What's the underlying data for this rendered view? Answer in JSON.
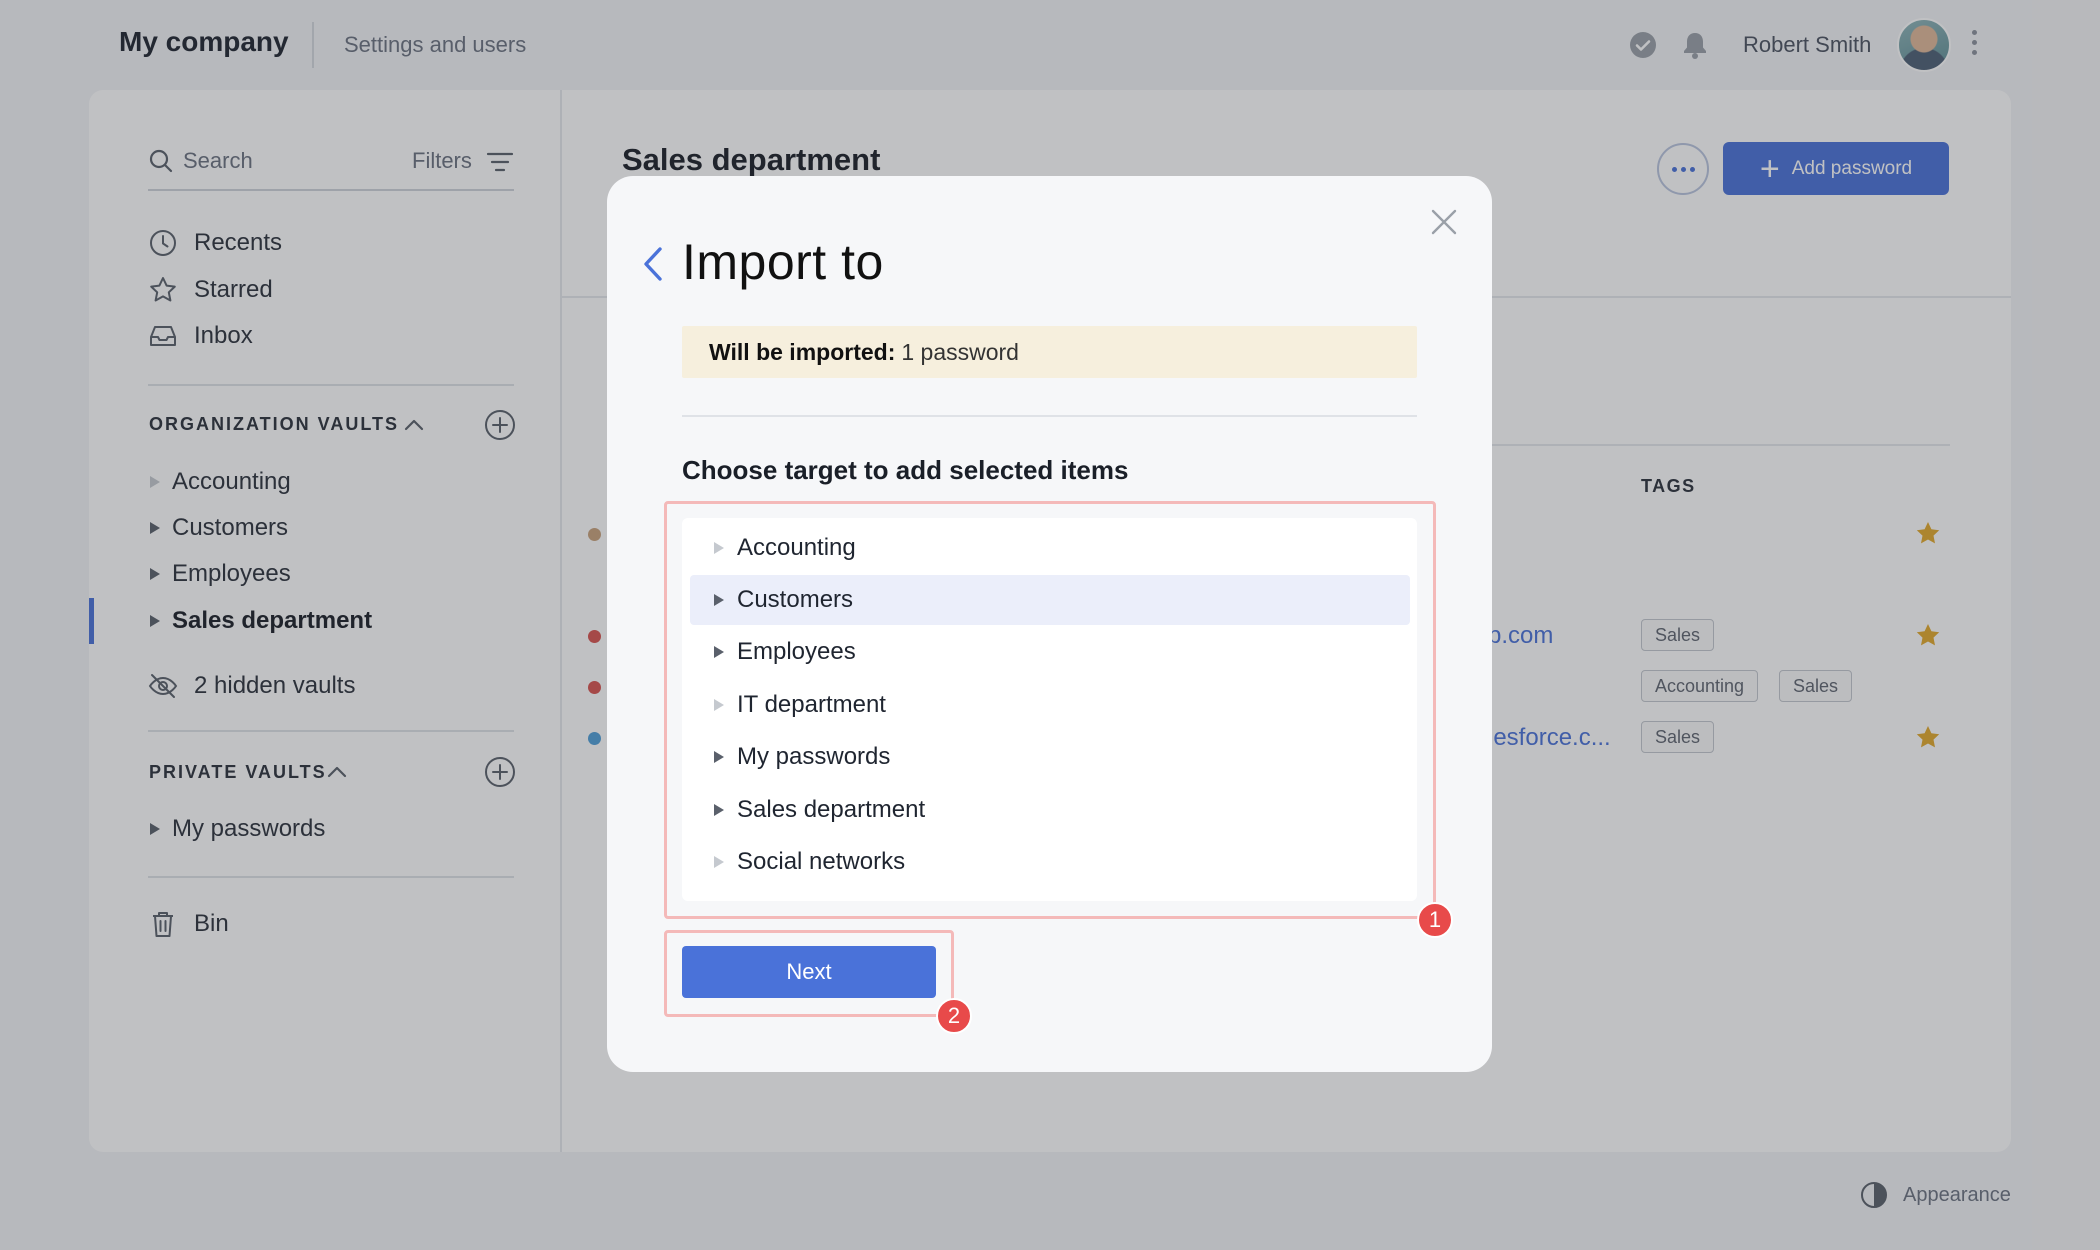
{
  "header": {
    "brand": "My company",
    "settings_link": "Settings and users",
    "user_name": "Robert Smith"
  },
  "sidebar": {
    "search_label": "Search",
    "filters_label": "Filters",
    "nav": [
      {
        "label": "Recents",
        "icon": "clock-icon"
      },
      {
        "label": "Starred",
        "icon": "star-outline-icon"
      },
      {
        "label": "Inbox",
        "icon": "inbox-icon"
      }
    ],
    "org_section_title": "ORGANIZATION VAULTS",
    "org_vaults": [
      "Accounting",
      "Customers",
      "Employees",
      "Sales department"
    ],
    "active_vault": "Sales department",
    "hidden_vaults": "2 hidden vaults",
    "private_section_title": "PRIVATE VAULTS",
    "private_vaults": [
      "My passwords"
    ],
    "bin": "Bin"
  },
  "content": {
    "title": "Sales department",
    "add_button": "Add password",
    "tags_header": "TAGS",
    "rows": [
      {
        "dot_color": "#c9a27c",
        "url": "",
        "tags": [],
        "starred": true
      },
      {
        "dot_color": "#d9534f",
        "url": "p.com",
        "tags": [
          "Sales"
        ],
        "starred": true
      },
      {
        "dot_color": "#d9534f",
        "url": "",
        "tags": [
          "Accounting",
          "Sales"
        ],
        "starred": false
      },
      {
        "dot_color": "#4f9fd9",
        "url": "lesforce.c...",
        "tags": [
          "Sales"
        ],
        "starred": true
      }
    ]
  },
  "footer": {
    "appearance": "Appearance"
  },
  "modal": {
    "title": "Import to",
    "notice_label": "Will be imported:",
    "notice_value": "1 password",
    "choose_label": "Choose target to add selected items",
    "targets": [
      {
        "label": "Accounting",
        "expandable": false,
        "selected": false
      },
      {
        "label": "Customers",
        "expandable": true,
        "selected": true
      },
      {
        "label": "Employees",
        "expandable": true,
        "selected": false
      },
      {
        "label": "IT department",
        "expandable": false,
        "selected": false
      },
      {
        "label": "My passwords",
        "expandable": true,
        "selected": false
      },
      {
        "label": "Sales department",
        "expandable": true,
        "selected": false
      },
      {
        "label": "Social networks",
        "expandable": false,
        "selected": false
      }
    ],
    "next_button": "Next",
    "badges": [
      "1",
      "2"
    ]
  },
  "colors": {
    "accent": "#4a72d9",
    "notice_bg": "#f6efdd",
    "highlight_border": "#f4b9b9",
    "badge_red": "#e84a4a",
    "star_gold": "#e3a92b"
  }
}
